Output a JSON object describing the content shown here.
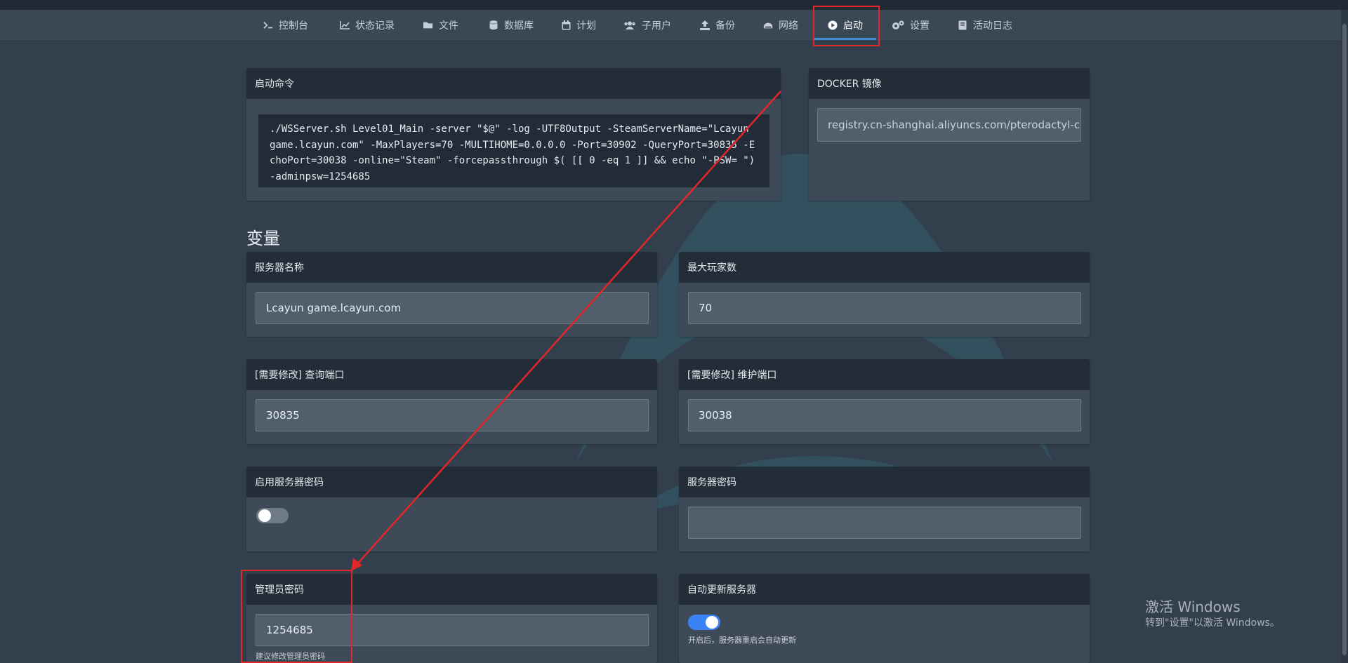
{
  "nav": {
    "items": [
      {
        "label": "控制台",
        "icon": "terminal-icon"
      },
      {
        "label": "状态记录",
        "icon": "chart-icon"
      },
      {
        "label": "文件",
        "icon": "folder-icon"
      },
      {
        "label": "数据库",
        "icon": "database-icon"
      },
      {
        "label": "计划",
        "icon": "calendar-icon"
      },
      {
        "label": "子用户",
        "icon": "users-icon"
      },
      {
        "label": "备份",
        "icon": "upload-icon"
      },
      {
        "label": "网络",
        "icon": "network-icon"
      },
      {
        "label": "启动",
        "icon": "play-icon"
      },
      {
        "label": "设置",
        "icon": "gears-icon"
      },
      {
        "label": "活动日志",
        "icon": "book-icon"
      }
    ],
    "active": "启动"
  },
  "startup": {
    "title": "启动命令",
    "command": "./WSServer.sh Level01_Main -server \"$@\" -log -UTF8Output -SteamServerName=\"Lcayun game.lcayun.com\" -MaxPlayers=70 -MULTIHOME=0.0.0.0 -Port=30902 -QueryPort=30835 -EchoPort=30038 -online=\"Steam\" -forcepassthrough $( [[ 0 -eq 1 ]] && echo \"-PSW= \") -adminpsw=1254685"
  },
  "docker": {
    "title": "DOCKER 镜像",
    "value": "registry.cn-shanghai.aliyuncs.com/pterodactyl-china"
  },
  "variables_heading": "变量",
  "variables": {
    "server_name": {
      "label": "服务器名称",
      "value": "Lcayun game.lcayun.com"
    },
    "max_players": {
      "label": "最大玩家数",
      "value": "70"
    },
    "query_port": {
      "label": "[需要修改] 查询端口",
      "value": "30835"
    },
    "echo_port": {
      "label": "[需要修改] 维护端口",
      "value": "30038"
    },
    "enable_password": {
      "label": "启用服务器密码",
      "enabled": false
    },
    "server_password": {
      "label": "服务器密码",
      "value": ""
    },
    "admin_password": {
      "label": "管理员密码",
      "value": "1254685",
      "hint": "建议修改管理员密码"
    },
    "auto_update": {
      "label": "自动更新服务器",
      "enabled": true,
      "hint": "开启后，服务器重启会自动更新"
    }
  },
  "watermark": {
    "line1": "激活 Windows",
    "line2": "转到\"设置\"以激活 Windows。"
  },
  "colors": {
    "annotation": "#e2262a",
    "accent": "#3e8fd8",
    "toggle_on": "#3b82f6"
  }
}
